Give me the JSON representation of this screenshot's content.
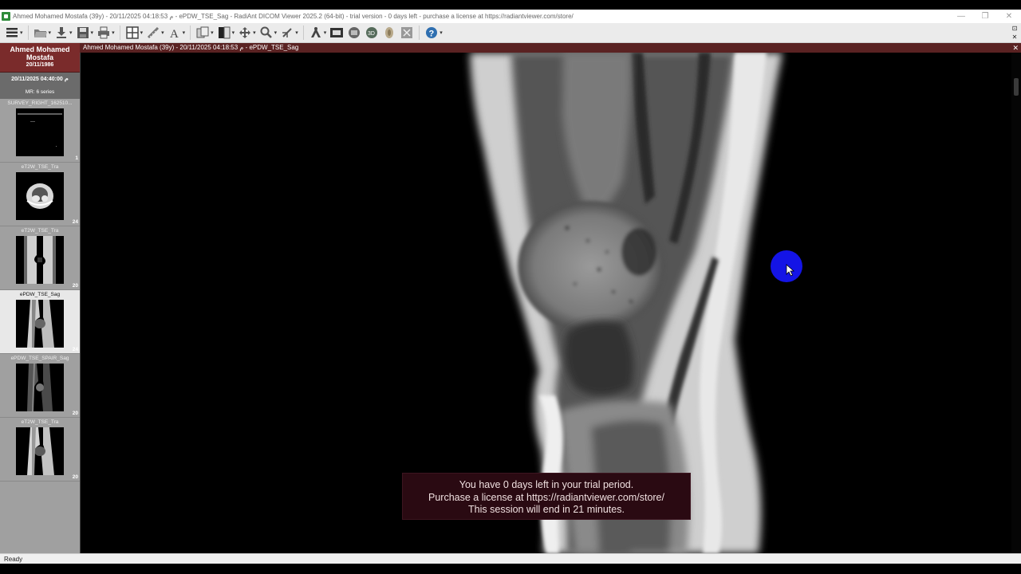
{
  "window": {
    "title": "Ahmed Mohamed Mostafa (39y) - 20/11/2025 04:18:53 م - ePDW_TSE_Sag - RadiAnt DICOM Viewer 2025.2 (64-bit) - trial version - 0 days left - purchase a license at https://radiantviewer.com/store/",
    "minimize": "—",
    "maximize": "❐",
    "close": "✕"
  },
  "toolbar": {
    "icons": [
      "menu-icon",
      "open-folder-icon",
      "download-icon",
      "save-icon",
      "print-icon",
      "layout-grid-icon",
      "measure-icon",
      "text-annotation-icon",
      "copy-icon",
      "window-level-icon",
      "pan-icon",
      "zoom-icon",
      "rotate-icon",
      "3d-mpr-icon",
      "cine-icon",
      "3d-volume-icon",
      "globe-icon",
      "fusion-icon",
      "tools-icon",
      "help-icon"
    ],
    "right": {
      "pin": "⊡",
      "close": "✕"
    }
  },
  "patient": {
    "name": "Ahmed Mohamed Mostafa",
    "dob": "20/11/1986"
  },
  "study": {
    "datetime": "20/11/2025 04:40:00 م",
    "modality_summary": "MR: 6 series"
  },
  "series": [
    {
      "label": "SURVEY_RIGHT_162510...",
      "count": "1",
      "active": false,
      "kind": "survey"
    },
    {
      "label": "eT2W_TSE_Tra",
      "count": "24",
      "active": false,
      "kind": "axial"
    },
    {
      "label": "eT2W_TSE_Tra",
      "count": "20",
      "active": false,
      "kind": "coronal"
    },
    {
      "label": "ePDW_TSE_Sag",
      "count": "24",
      "active": true,
      "kind": "sagittal"
    },
    {
      "label": "ePDW_TSE_SPAIR_Sag",
      "count": "20",
      "active": false,
      "kind": "sagittal-dark"
    },
    {
      "label": "eT2W_TSE_Tra",
      "count": "20",
      "active": false,
      "kind": "sagittal"
    }
  ],
  "viewer": {
    "header": "Ahmed Mohamed Mostafa (39y) - 20/11/2025 04:18:53 م - ePDW_TSE_Sag",
    "close": "✕"
  },
  "trial_notice": {
    "line1": "You have 0 days left in your trial period.",
    "line2": "Purchase a license at https://radiantviewer.com/store/",
    "line3": "This session will end in 21 minutes."
  },
  "status": {
    "text": "Ready"
  },
  "colors": {
    "patient_bg": "#7a2b2b",
    "viewer_header_bg": "#5a2222",
    "cursor_highlight": "#1414e6"
  }
}
